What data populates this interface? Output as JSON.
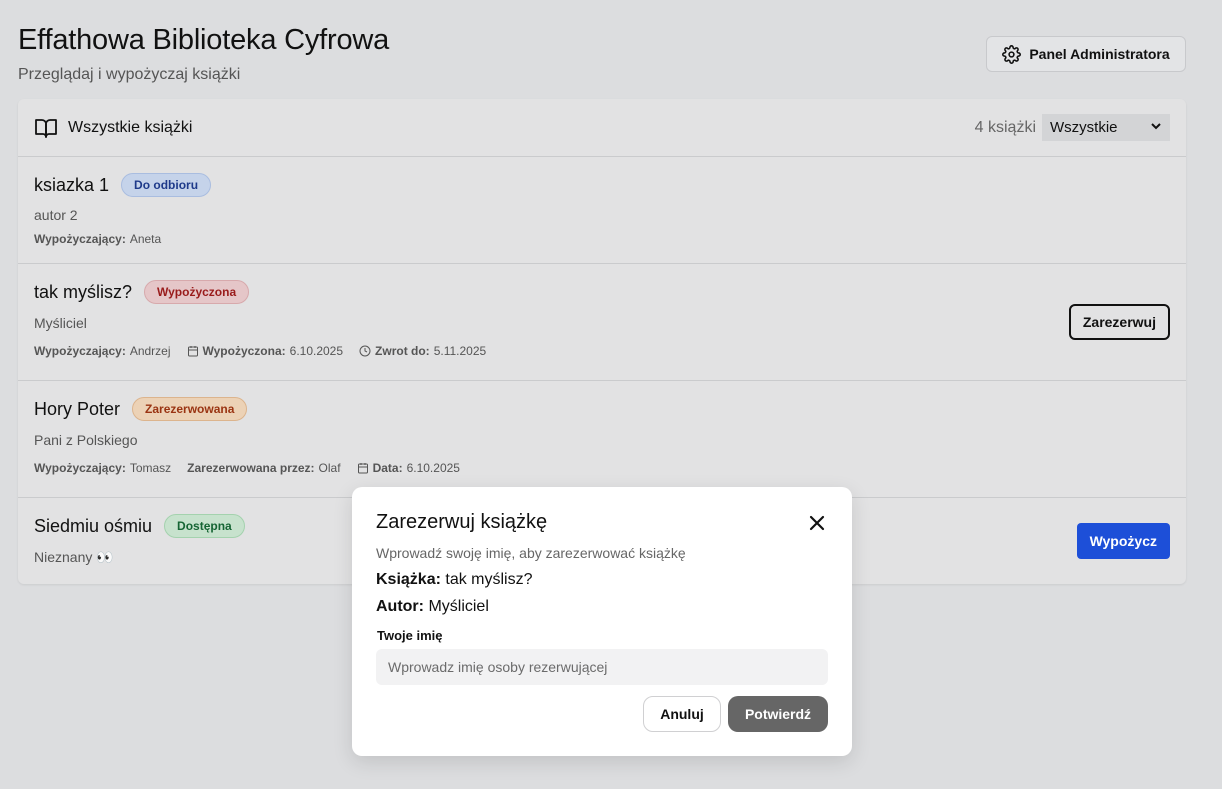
{
  "header": {
    "title": "Effathowa Biblioteka Cyfrowa",
    "subtitle": "Przeglądaj i wypożyczaj książki",
    "admin_button_label": "Panel Administratora"
  },
  "library": {
    "title": "Wszystkie książki",
    "count_label": "4 książki",
    "filter_selected": "Wszystkie",
    "books": [
      {
        "title": "ksiazka 1",
        "status": "Do odbioru",
        "author": "autor 2",
        "borrower_label": "Wypożyczający:",
        "borrower": "Aneta"
      },
      {
        "title": "tak myślisz?",
        "status": "Wypożyczona",
        "author": "Myśliciel",
        "borrower_label": "Wypożyczający:",
        "borrower": "Andrzej",
        "borrowed_label": "Wypożyczona:",
        "borrowed_date": "6.10.2025",
        "due_label": "Zwrot do:",
        "due_date": "5.11.2025",
        "action_label": "Zarezerwuj"
      },
      {
        "title": "Hory Poter",
        "status": "Zarezerwowana",
        "author": "Pani z Polskiego",
        "borrower_label": "Wypożyczający:",
        "borrower": "Tomasz",
        "reserved_by_label": "Zarezerwowana przez:",
        "reserved_by": "Olaf",
        "date_label": "Data:",
        "date": "6.10.2025"
      },
      {
        "title": "Siedmiu ośmiu",
        "status": "Dostępna",
        "author": "Nieznany 👀",
        "action_label": "Wypożycz"
      }
    ]
  },
  "modal": {
    "title": "Zarezerwuj książkę",
    "description": "Wprowadź swoję imię, aby zarezerwować książkę",
    "book_label": "Książka:",
    "book_value": "tak myślisz?",
    "author_label": "Autor:",
    "author_value": "Myśliciel",
    "name_label": "Twoje imię",
    "name_value": "",
    "name_placeholder": "Wprowadz imię osoby rezerwującej",
    "cancel_label": "Anuluj",
    "confirm_label": "Potwierdź"
  },
  "colors": {
    "background": "#dcdddf",
    "primary": "#1d4fd8",
    "badge_blue": "#c5d3ea",
    "badge_red": "#e5c6c8",
    "badge_orange": "#ecd2b6",
    "badge_green": "#c7e2cd",
    "confirm_button": "#666666"
  }
}
